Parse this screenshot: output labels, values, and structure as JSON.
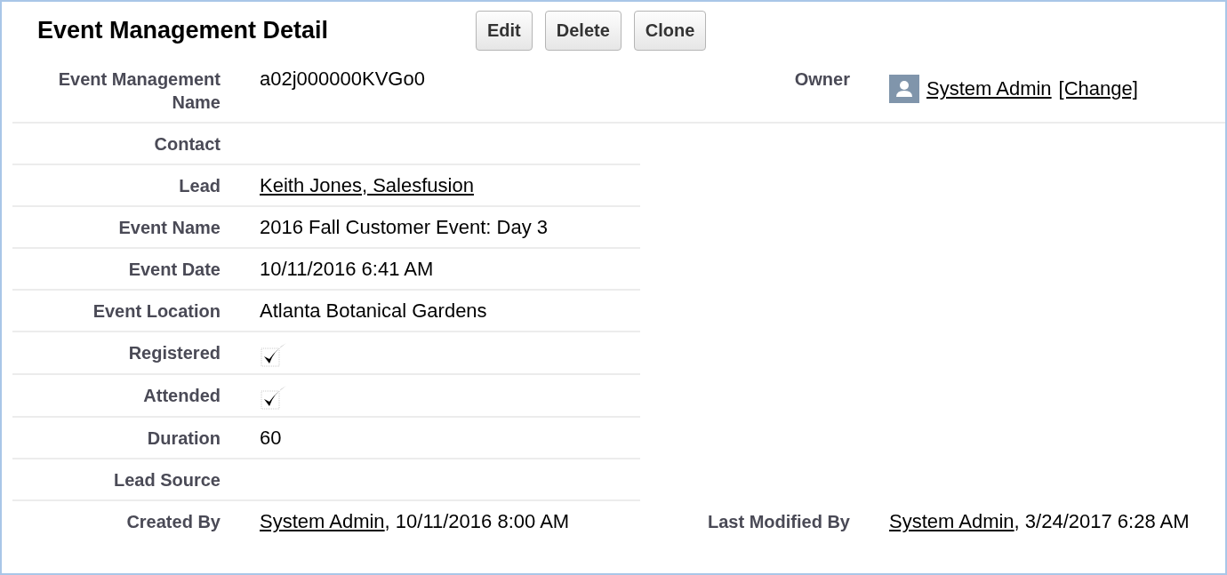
{
  "title": "Event Management Detail",
  "buttons": [
    "Edit",
    "Delete",
    "Clone"
  ],
  "rows": [
    {
      "left": {
        "label": "Event Management Name",
        "kind": "text",
        "parts": [
          {
            "kind": "text",
            "text": "a02j000000KVGo0"
          }
        ]
      },
      "right": {
        "label": "Owner",
        "kind": "user",
        "parts": [
          {
            "kind": "link",
            "text": "System Admin"
          },
          {
            "kind": "link",
            "text": "[Change]"
          }
        ]
      }
    },
    {
      "left": {
        "label": "Contact",
        "kind": "text"
      }
    },
    {
      "left": {
        "label": "Lead",
        "kind": "text",
        "parts": [
          {
            "kind": "link",
            "text": "Keith Jones, Salesfusion"
          }
        ]
      }
    },
    {
      "left": {
        "label": "Event Name",
        "kind": "text",
        "parts": [
          {
            "kind": "text",
            "text": "2016 Fall Customer Event: Day 3"
          }
        ]
      }
    },
    {
      "left": {
        "label": "Event Date",
        "kind": "text",
        "parts": [
          {
            "kind": "text",
            "text": "10/11/2016 6:41 AM"
          }
        ]
      }
    },
    {
      "left": {
        "label": "Event Location",
        "kind": "text",
        "parts": [
          {
            "kind": "text",
            "text": "Atlanta Botanical Gardens"
          }
        ]
      }
    },
    {
      "left": {
        "label": "Registered",
        "kind": "checkbox",
        "checked": true
      }
    },
    {
      "left": {
        "label": "Attended",
        "kind": "checkbox",
        "checked": true
      }
    },
    {
      "left": {
        "label": "Duration",
        "kind": "text",
        "parts": [
          {
            "kind": "text",
            "text": "60"
          }
        ]
      }
    },
    {
      "left": {
        "label": "Lead Source",
        "kind": "text"
      }
    },
    {
      "left": {
        "label": "Created By",
        "kind": "text",
        "parts": [
          {
            "kind": "link",
            "text": "System Admin"
          },
          {
            "kind": "text",
            "text": ", 10/11/2016 8:00 AM"
          }
        ]
      },
      "right": {
        "label": "Last Modified By",
        "kind": "text",
        "parts": [
          {
            "kind": "link",
            "text": "System Admin"
          },
          {
            "kind": "text",
            "text": ", 3/24/2017 6:28 AM"
          }
        ]
      }
    }
  ]
}
